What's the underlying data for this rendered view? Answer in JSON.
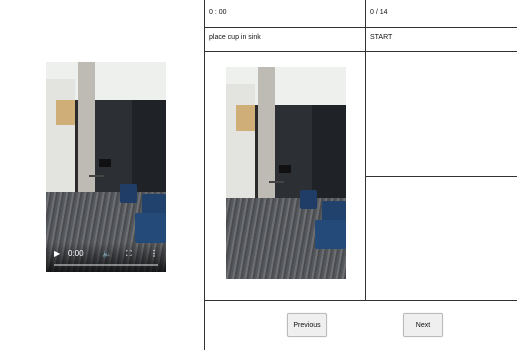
{
  "header": {
    "timer": "0 : 00",
    "step_counter": "0 / 14"
  },
  "task": {
    "instruction": "place cup in sink",
    "status": "START"
  },
  "video": {
    "time": "0:00"
  },
  "buttons": {
    "previous": "Previous",
    "next": "Next"
  }
}
